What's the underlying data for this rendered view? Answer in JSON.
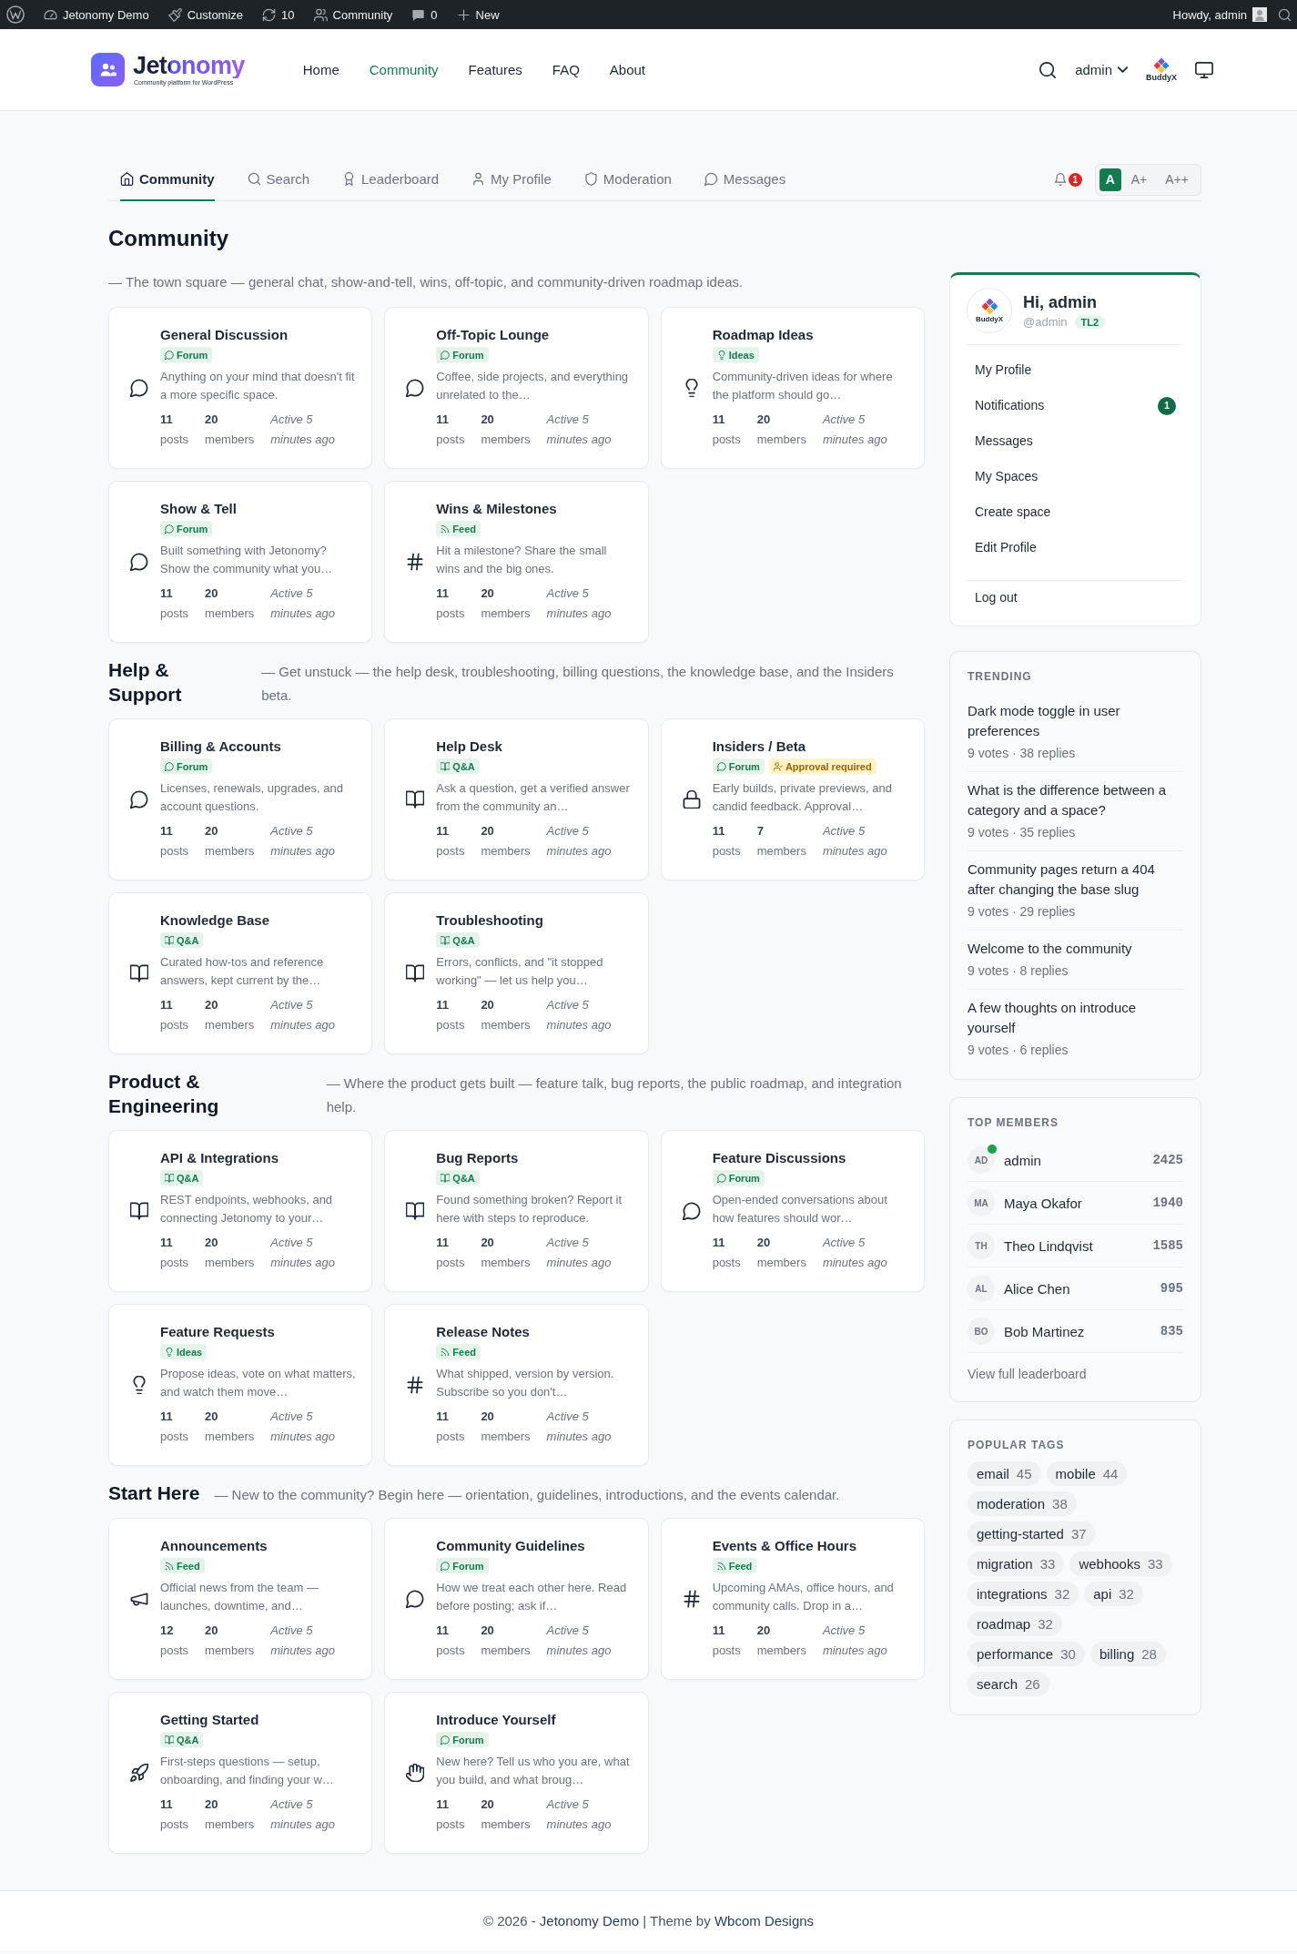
{
  "admin_bar": {
    "items": [
      {
        "kind": "site",
        "label": "Jetonomy Demo"
      },
      {
        "kind": "customize",
        "label": "Customize"
      },
      {
        "kind": "updates",
        "label": "10"
      },
      {
        "kind": "community",
        "label": "Community"
      },
      {
        "kind": "comments",
        "label": "0"
      },
      {
        "kind": "new",
        "label": "New"
      }
    ],
    "greeting": "Howdy, admin"
  },
  "header": {
    "logo_text": "Jetonomy",
    "tagline": "Community platform for WordPress",
    "nav": [
      {
        "label": "Home",
        "selected": false
      },
      {
        "label": "Community",
        "selected": true
      },
      {
        "label": "Features",
        "selected": false
      },
      {
        "label": "FAQ",
        "selected": false
      },
      {
        "label": "About",
        "selected": false
      }
    ],
    "user": "admin",
    "user_logo_text": "BuddyX"
  },
  "tabs": [
    {
      "label": "Community",
      "kind": "home",
      "selected": true
    },
    {
      "label": "Search",
      "kind": "search",
      "selected": false
    },
    {
      "label": "Leaderboard",
      "kind": "leaderboard",
      "selected": false
    },
    {
      "label": "My Profile",
      "kind": "profile",
      "selected": false
    },
    {
      "label": "Moderation",
      "kind": "moderation",
      "selected": false
    },
    {
      "label": "Messages",
      "kind": "messages",
      "selected": false
    }
  ],
  "notifications": {
    "count": "1"
  },
  "font_sizes": [
    {
      "label": "A",
      "selected": true
    },
    {
      "label": "A+",
      "selected": false
    },
    {
      "label": "A++",
      "selected": false
    }
  ],
  "title": "Community",
  "sections": [
    {
      "description": "— The town square — general chat, show-and-tell, wins, off-topic, and community-driven roadmap ideas.",
      "spaces": [
        {
          "name": "General Discussion",
          "kind": "discussion",
          "badges": [
            {
              "label": "Forum",
              "kind": "forum"
            }
          ],
          "description": "Anything on your mind that doesn't fit a more specific space.",
          "stats": [
            "**11** posts",
            "**20** members"
          ],
          "activity": "Active 5 minutes ago"
        },
        {
          "name": "Off-Topic Lounge",
          "kind": "discussion",
          "badges": [
            {
              "label": "Forum",
              "kind": "forum"
            }
          ],
          "description": "Coffee, side projects, and everything unrelated to the…",
          "stats": [
            "**11** posts",
            "**20** members"
          ],
          "activity": "Active 5 minutes ago"
        },
        {
          "name": "Roadmap Ideas",
          "kind": "idea",
          "badges": [
            {
              "label": "Ideas",
              "kind": "ideas"
            }
          ],
          "description": "Community-driven ideas for where the platform should go…",
          "stats": [
            "**11** posts",
            "**20** members"
          ],
          "activity": "Active 5 minutes ago"
        },
        {
          "name": "Show & Tell",
          "kind": "discussion",
          "badges": [
            {
              "label": "Forum",
              "kind": "forum"
            }
          ],
          "description": "Built something with Jetonomy? Show the community what you…",
          "stats": [
            "**11** posts",
            "**20** members"
          ],
          "activity": "Active 5 minutes ago"
        },
        {
          "name": "Wins & Milestones",
          "kind": "channel",
          "badges": [
            {
              "label": "Feed",
              "kind": "feed"
            }
          ],
          "description": "Hit a milestone? Share the small wins and the big ones.",
          "stats": [
            "**11** posts",
            "**20** members"
          ],
          "activity": "Active 5 minutes ago"
        }
      ]
    },
    {
      "name": "Help & Support",
      "description": "— Get unstuck — the help desk, troubleshooting, billing questions, the knowledge base, and the Insiders beta.",
      "spaces": [
        {
          "name": "Billing & Accounts",
          "kind": "discussion",
          "badges": [
            {
              "label": "Forum",
              "kind": "forum"
            }
          ],
          "description": "Licenses, renewals, upgrades, and account questions.",
          "stats": [
            "**11** posts",
            "**20** members"
          ],
          "activity": "Active 5 minutes ago"
        },
        {
          "name": "Help Desk",
          "kind": "docs",
          "badges": [
            {
              "label": "Q&A",
              "kind": "qa"
            }
          ],
          "description": "Ask a question, get a verified answer from the community an…",
          "stats": [
            "**11** posts",
            "**20** members"
          ],
          "activity": "Active 5 minutes ago"
        },
        {
          "name": "Insiders / Beta",
          "kind": "locked",
          "badges": [
            {
              "label": "Forum",
              "kind": "forum"
            },
            {
              "label": "Approval required",
              "kind": "approval"
            }
          ],
          "description": "Early builds, private previews, and candid feedback. Approval…",
          "stats": [
            "**11** posts",
            "**7** members"
          ],
          "activity": "Active 5 minutes ago"
        },
        {
          "name": "Knowledge Base",
          "kind": "docs",
          "badges": [
            {
              "label": "Q&A",
              "kind": "qa"
            }
          ],
          "description": "Curated how-tos and reference answers, kept current by the…",
          "stats": [
            "**11** posts",
            "**20** members"
          ],
          "activity": "Active 5 minutes ago"
        },
        {
          "name": "Troubleshooting",
          "kind": "docs",
          "badges": [
            {
              "label": "Q&A",
              "kind": "qa"
            }
          ],
          "description": "Errors, conflicts, and \"it stopped working\" — let us help you…",
          "stats": [
            "**11** posts",
            "**20** members"
          ],
          "activity": "Active 5 minutes ago"
        }
      ]
    },
    {
      "name": "Product & Engineering",
      "description": "— Where the product gets built — feature talk, bug reports, the public roadmap, and integration help.",
      "spaces": [
        {
          "name": "API & Integrations",
          "kind": "docs",
          "badges": [
            {
              "label": "Q&A",
              "kind": "qa"
            }
          ],
          "description": "REST endpoints, webhooks, and connecting Jetonomy to your…",
          "stats": [
            "**11** posts",
            "**20** members"
          ],
          "activity": "Active 5 minutes ago"
        },
        {
          "name": "Bug Reports",
          "kind": "docs",
          "badges": [
            {
              "label": "Q&A",
              "kind": "qa"
            }
          ],
          "description": "Found something broken? Report it here with steps to reproduce.",
          "stats": [
            "**11** posts",
            "**20** members"
          ],
          "activity": "Active 5 minutes ago"
        },
        {
          "name": "Feature Discussions",
          "kind": "discussion",
          "badges": [
            {
              "label": "Forum",
              "kind": "forum"
            }
          ],
          "description": "Open-ended conversations about how features should wor…",
          "stats": [
            "**11** posts",
            "**20** members"
          ],
          "activity": "Active 5 minutes ago"
        },
        {
          "name": "Feature Requests",
          "kind": "idea",
          "badges": [
            {
              "label": "Ideas",
              "kind": "ideas"
            }
          ],
          "description": "Propose ideas, vote on what matters, and watch them move…",
          "stats": [
            "**11** posts",
            "**20** members"
          ],
          "activity": "Active 5 minutes ago"
        },
        {
          "name": "Release Notes",
          "kind": "channel",
          "badges": [
            {
              "label": "Feed",
              "kind": "feed"
            }
          ],
          "description": "What shipped, version by version. Subscribe so you don't…",
          "stats": [
            "**11** posts",
            "**20** members"
          ],
          "activity": "Active 5 minutes ago"
        }
      ]
    },
    {
      "name": "Start Here",
      "description": "— New to the community? Begin here — orientation, guidelines, introductions, and the events calendar.",
      "spaces": [
        {
          "name": "Announcements",
          "kind": "announcement",
          "badges": [
            {
              "label": "Feed",
              "kind": "feed"
            }
          ],
          "description": "Official news from the team — launches, downtime, and…",
          "stats": [
            "**12** posts",
            "**20** members"
          ],
          "activity": "Active 5 minutes ago"
        },
        {
          "name": "Community Guidelines",
          "kind": "discussion",
          "badges": [
            {
              "label": "Forum",
              "kind": "forum"
            }
          ],
          "description": "How we treat each other here. Read before posting; ask if…",
          "stats": [
            "**11** posts",
            "**20** members"
          ],
          "activity": "Active 5 minutes ago"
        },
        {
          "name": "Events & Office Hours",
          "kind": "channel",
          "badges": [
            {
              "label": "Feed",
              "kind": "feed"
            }
          ],
          "description": "Upcoming AMAs, office hours, and community calls. Drop in a…",
          "stats": [
            "**11** posts",
            "**20** members"
          ],
          "activity": "Active 5 minutes ago"
        },
        {
          "name": "Getting Started",
          "kind": "onboarding",
          "badges": [
            {
              "label": "Q&A",
              "kind": "qa"
            }
          ],
          "description": "First-steps questions — setup, onboarding, and finding your w…",
          "stats": [
            "**11** posts",
            "**20** members"
          ],
          "activity": "Active 5 minutes ago"
        },
        {
          "name": "Introduce Yourself",
          "kind": "welcome",
          "badges": [
            {
              "label": "Forum",
              "kind": "forum"
            }
          ],
          "description": "New here? Tell us who you are, what you build, and what broug…",
          "stats": [
            "**11** posts",
            "**20** members"
          ],
          "activity": "Active 5 minutes ago"
        }
      ]
    }
  ],
  "profile": {
    "avatar_text": "BuddyX",
    "greeting": "Hi, admin",
    "handle": "@admin",
    "trust_level": "TL2",
    "menu": [
      {
        "label": "My Profile"
      },
      {
        "label": "Notifications",
        "count": "1"
      },
      {
        "label": "Messages"
      },
      {
        "label": "My Spaces"
      },
      {
        "label": "Create space"
      },
      {
        "label": "Edit Profile"
      }
    ],
    "logout": "Log out"
  },
  "trending": {
    "title": "TRENDING",
    "items": [
      {
        "title": "Dark mode toggle in user preferences",
        "meta": "9 votes · 38 replies"
      },
      {
        "title": "What is the difference between a category and a space?",
        "meta": "9 votes · 35 replies"
      },
      {
        "title": "Community pages return a 404 after changing the base slug",
        "meta": "9 votes · 29 replies"
      },
      {
        "title": "Welcome to the community",
        "meta": "9 votes · 8 replies"
      },
      {
        "title": "A few thoughts on introduce yourself",
        "meta": "9 votes · 6 replies"
      }
    ]
  },
  "top_members": {
    "title": "TOP MEMBERS",
    "members": [
      {
        "initials": "AD",
        "name": "admin",
        "points": "2425",
        "online": true
      },
      {
        "initials": "MA",
        "name": "Maya Okafor",
        "points": "1940",
        "online": false
      },
      {
        "initials": "TH",
        "name": "Theo Lindqvist",
        "points": "1585",
        "online": false
      },
      {
        "initials": "AL",
        "name": "Alice Chen",
        "points": "995",
        "online": false
      },
      {
        "initials": "BO",
        "name": "Bob Martinez",
        "points": "835",
        "online": false
      }
    ],
    "link": "View full leaderboard"
  },
  "popular_tags": {
    "title": "POPULAR TAGS",
    "tags": [
      {
        "name": "email",
        "count": "45"
      },
      {
        "name": "mobile",
        "count": "44"
      },
      {
        "name": "moderation",
        "count": "38"
      },
      {
        "name": "getting-started",
        "count": "37"
      },
      {
        "name": "migration",
        "count": "33"
      },
      {
        "name": "webhooks",
        "count": "33"
      },
      {
        "name": "integrations",
        "count": "32"
      },
      {
        "name": "api",
        "count": "32"
      },
      {
        "name": "roadmap",
        "count": "32"
      },
      {
        "name": "performance",
        "count": "30"
      },
      {
        "name": "billing",
        "count": "28"
      },
      {
        "name": "search",
        "count": "26"
      }
    ]
  },
  "footer": {
    "parts": [
      {
        "text": "© 2026 - ",
        "link": false
      },
      {
        "text": "Jetonomy Demo",
        "link": true
      },
      {
        "text": " | Theme by ",
        "link": false
      },
      {
        "text": "Wbcom Designs",
        "link": true
      }
    ]
  }
}
